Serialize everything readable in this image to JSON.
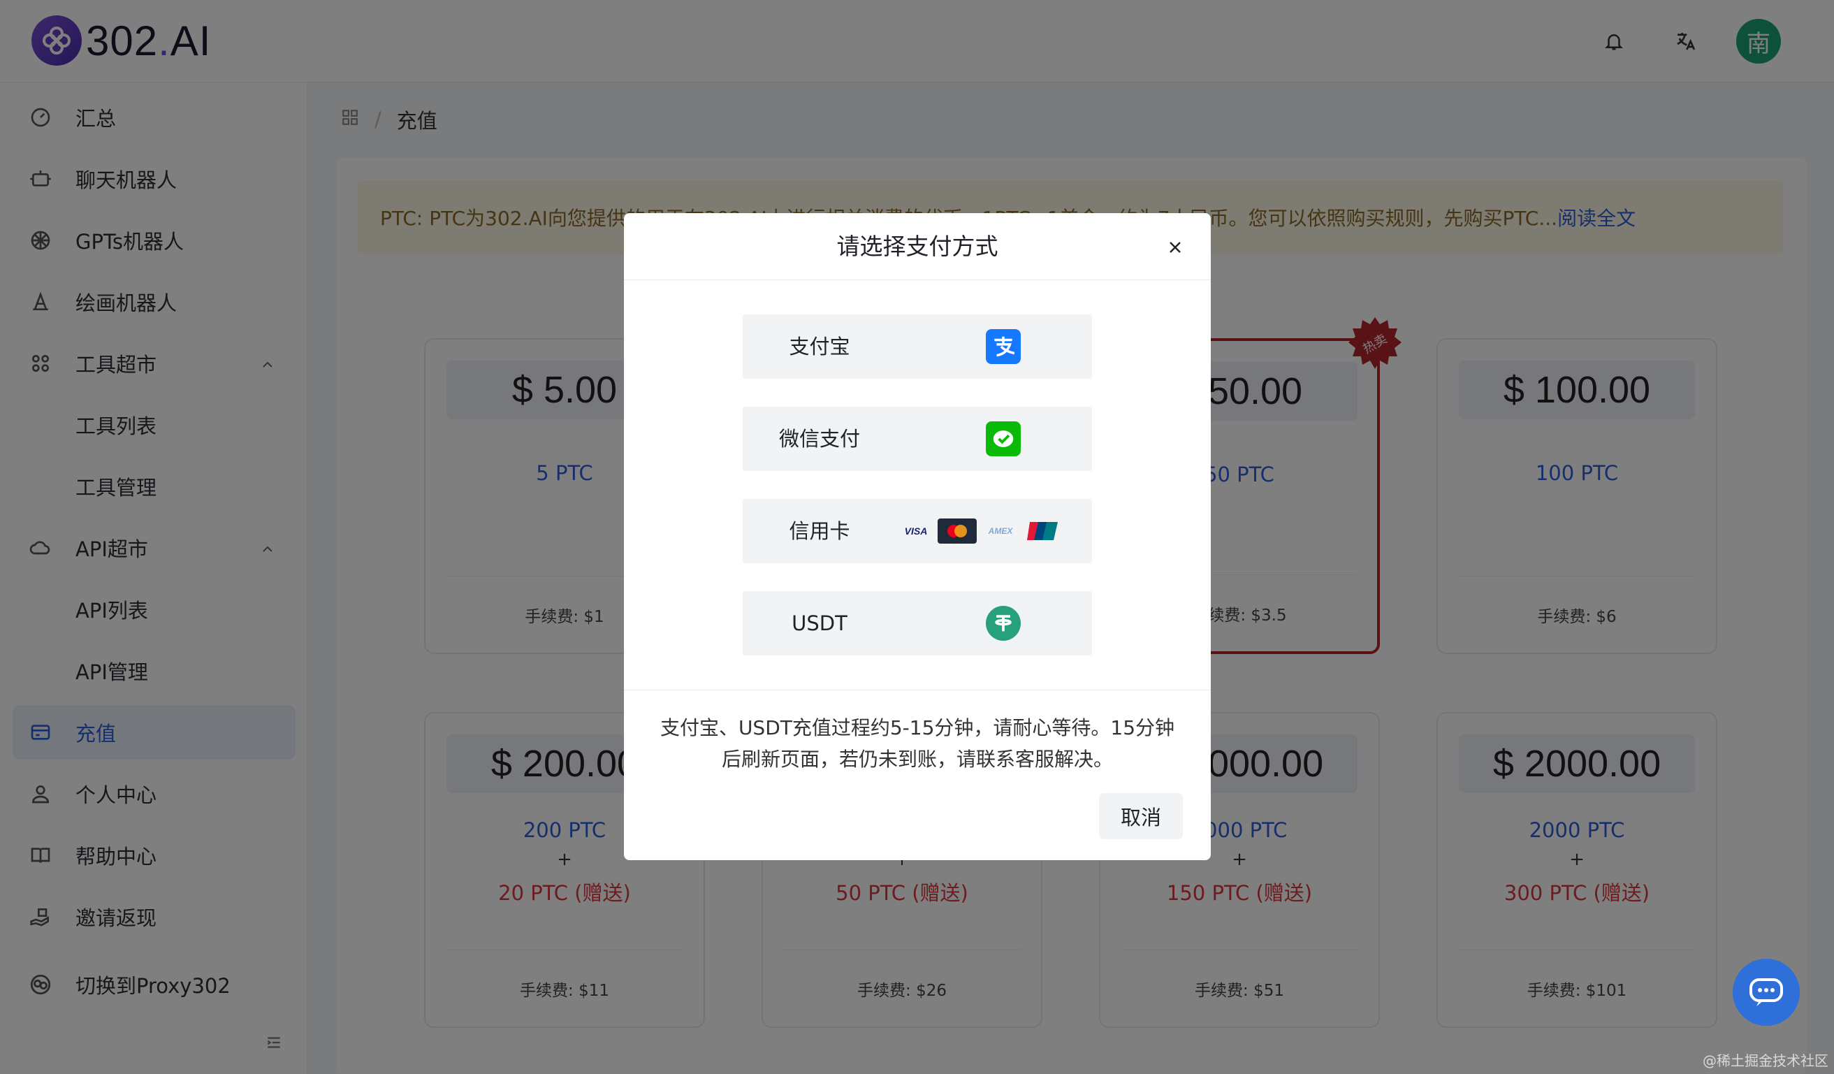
{
  "header": {
    "brand_prefix": "302",
    "brand_dot": ".",
    "brand_suffix": "AI",
    "avatar_initial": "南"
  },
  "sidebar": {
    "items": [
      {
        "label": "汇总",
        "icon": "dashboard-icon"
      },
      {
        "label": "聊天机器人",
        "icon": "robot-icon"
      },
      {
        "label": "GPTs机器人",
        "icon": "openai-icon"
      },
      {
        "label": "绘画机器人",
        "icon": "paint-icon"
      },
      {
        "label": "工具超市",
        "icon": "grid-icon"
      },
      {
        "label": "工具列表"
      },
      {
        "label": "工具管理"
      },
      {
        "label": "API超市",
        "icon": "cloud-api-icon"
      },
      {
        "label": "API列表"
      },
      {
        "label": "API管理"
      },
      {
        "label": "充值",
        "icon": "card-icon"
      },
      {
        "label": "个人中心",
        "icon": "user-icon"
      },
      {
        "label": "帮助中心",
        "icon": "book-icon"
      },
      {
        "label": "邀请返现",
        "icon": "gift-hand-icon"
      },
      {
        "label": "切换到Proxy302",
        "icon": "switch-icon"
      }
    ]
  },
  "breadcrumb": {
    "current": "充值"
  },
  "notice": {
    "text": "PTC: PTC为302.AI向您提供的用于在302.AI上进行相关消费的代币，1PTC=1美金，约为7人民币。您可以依照购买规则，先购买PTC...",
    "link": "阅读全文"
  },
  "cards": [
    {
      "price": "$ 5.00",
      "ptc": "5 PTC",
      "fee": "手续费: $1"
    },
    {
      "price": "$ 50.00",
      "ptc": "50 PTC",
      "fee": "手续费: $3.5",
      "badge": "热卖"
    },
    {
      "price": "$ 100.00",
      "ptc": "100 PTC",
      "fee": "手续费: $6"
    },
    {
      "price": "$ 200.00",
      "ptc": "200 PTC",
      "plus": "+",
      "bonus": "20 PTC (赠送)",
      "fee": "手续费: $11"
    },
    {
      "plus": "+",
      "bonus": "50 PTC (赠送)",
      "fee": "手续费: $26"
    },
    {
      "price": "$ 1000.00",
      "ptc": "1000 PTC",
      "plus": "+",
      "bonus": "150 PTC (赠送)",
      "fee": "手续费: $51"
    },
    {
      "price": "$ 2000.00",
      "ptc": "2000 PTC",
      "plus": "+",
      "bonus": "300 PTC (赠送)",
      "fee": "手续费: $101"
    }
  ],
  "modal": {
    "title": "请选择支付方式",
    "options": [
      {
        "label": "支付宝",
        "icon": "alipay-icon"
      },
      {
        "label": "微信支付",
        "icon": "wechat-pay-icon"
      },
      {
        "label": "信用卡",
        "icons": [
          "visa-icon",
          "mastercard-icon",
          "amex-icon",
          "unionpay-icon"
        ]
      },
      {
        "label": "USDT",
        "icon": "tether-icon"
      }
    ],
    "note": "支付宝、USDT充值过程约5-15分钟，请耐心等待。15分钟后刷新页面，若仍未到账，请联系客服解决。",
    "cancel": "取消"
  },
  "colors": {
    "accent": "#2d5fd8",
    "hot": "#b3242a",
    "bonus": "#d9363e",
    "alipay": "#1677ff",
    "wechat": "#09bb07",
    "usdt": "#26a17b"
  },
  "watermark": "@稀土掘金技术社区"
}
